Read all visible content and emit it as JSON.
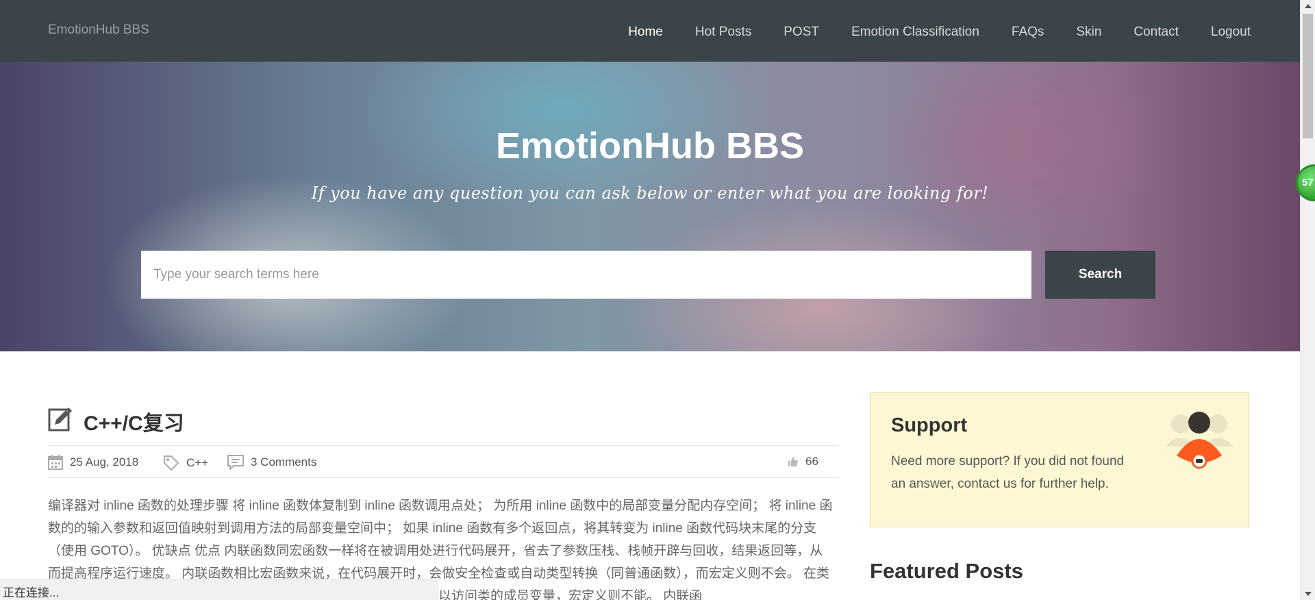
{
  "navbar": {
    "brand": "EmotionHub BBS",
    "items": [
      {
        "label": "Home",
        "active": true
      },
      {
        "label": "Hot Posts"
      },
      {
        "label": "POST"
      },
      {
        "label": "Emotion Classification"
      },
      {
        "label": "FAQs"
      },
      {
        "label": "Skin"
      },
      {
        "label": "Contact"
      },
      {
        "label": "Logout"
      }
    ]
  },
  "hero": {
    "title": "EmotionHub BBS",
    "subtitle": "If you have any question you can ask below or enter what you are looking for!",
    "search_placeholder": "Type your search terms here",
    "search_button": "Search"
  },
  "post": {
    "title": "C++/C复习",
    "date": "25 Aug, 2018",
    "tag": "C++",
    "comments": "3 Comments",
    "likes": "66",
    "body": "编译器对 inline 函数的处理步骤  将 inline 函数体复制到 inline 函数调用点处；  为所用 inline 函数中的局部变量分配内存空间；  将 inline 函数的的输入参数和返回值映射到调用方法的局部变量空间中；  如果 inline 函数有多个返回点，将其转变为 inline 函数代码块末尾的分支（使用 GOTO）。  优缺点  优点  内联函数同宏函数一样将在被调用处进行代码展开，省去了参数压栈、栈帧开辟与回收，结果返回等，从而提高程序运行速度。 内联函数相比宏函数来说，在代码展开时，会做安全检查或自动类型转换（同普通函数），而宏定义则不会。 在类中声明同时定义的成员函数，自动转化为内联函数，因此内联函数可以访问类的成员变量，宏定义则不能。 内联函"
  },
  "sidebar": {
    "support_title": "Support",
    "support_text": "Need more support? If you did not found an answer, contact us for further help.",
    "featured_title": "Featured Posts"
  },
  "status_bar": {
    "text": "正在连接..."
  },
  "float_badge": {
    "text": "57"
  },
  "colors": {
    "navbar_bg": "#3b4449",
    "button_bg": "#3b4449",
    "support_bg": "#fdf8d3",
    "support_avatar_accent": "#ff5a1f"
  }
}
